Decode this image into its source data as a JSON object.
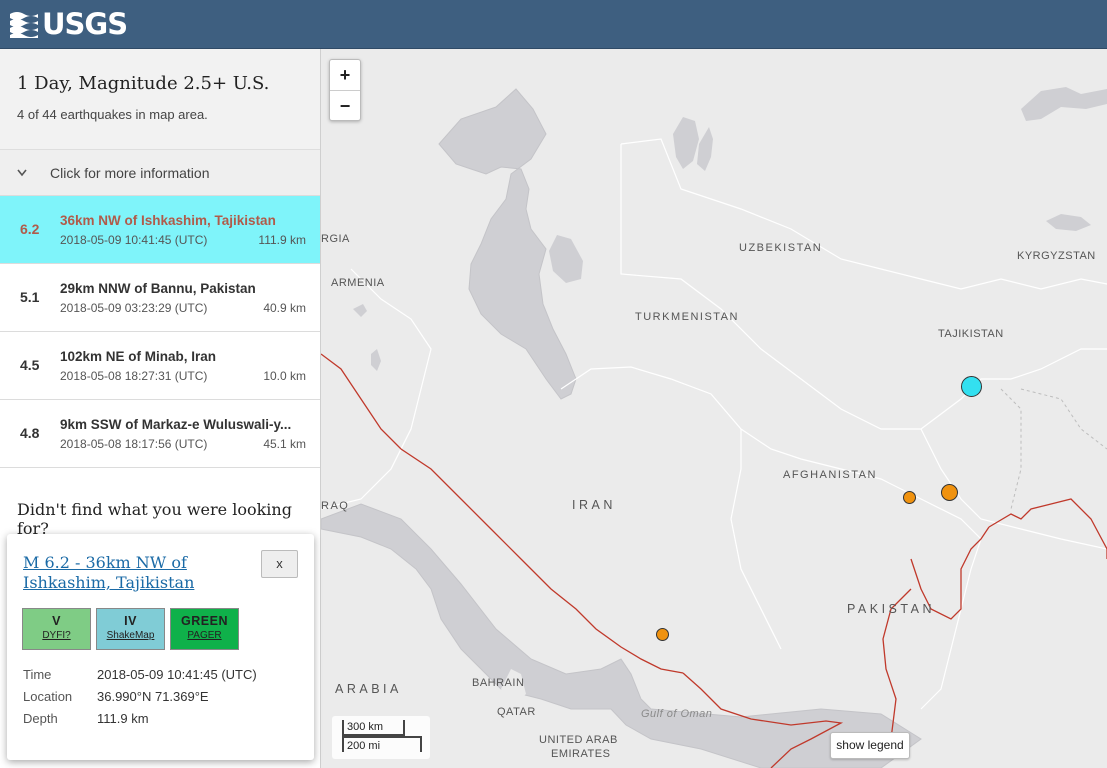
{
  "header": {
    "logo_text": "USGS"
  },
  "sidebar": {
    "title": "1 Day, Magnitude 2.5+ U.S.",
    "subtitle": "4 of 44 earthquakes in map area.",
    "more_info": "Click for more information",
    "quakes": [
      {
        "mag": "6.2",
        "place": "36km NW of Ishkashim, Tajikistan",
        "time": "2018-05-09 10:41:45 (UTC)",
        "depth": "111.9 km",
        "selected": true
      },
      {
        "mag": "5.1",
        "place": "29km NNW of Bannu, Pakistan",
        "time": "2018-05-09 03:23:29 (UTC)",
        "depth": "40.9 km",
        "selected": false
      },
      {
        "mag": "4.5",
        "place": "102km NE of Minab, Iran",
        "time": "2018-05-08 18:27:31 (UTC)",
        "depth": "10.0 km",
        "selected": false
      },
      {
        "mag": "4.8",
        "place": "9km SSW of Markaz-e Wuluswali-y...",
        "time": "2018-05-08 18:17:56 (UTC)",
        "depth": "45.1 km",
        "selected": false
      }
    ],
    "didnt_find": "Didn't find what you were looking for?"
  },
  "map": {
    "zoom_in": "+",
    "zoom_out": "−",
    "scale_km": "300 km",
    "scale_mi": "200 mi",
    "show_legend": "show legend",
    "labels": {
      "uzbekistan": "UZBEKISTAN",
      "kyrgyzstan": "KYRGYZSTAN",
      "turkmenistan": "TURKMENISTAN",
      "tajikistan": "TAJIKISTAN",
      "afghanistan": "AFGHANISTAN",
      "iran": "IRAN",
      "pakistan": "PAKISTAN",
      "armenia": "ARMENIA",
      "georgia": "RGIA",
      "iraq": "RAQ",
      "arabia": "ARABIA",
      "bahrain": "BAHRAIN",
      "qatar": "QATAR",
      "uae_1": "UNITED ARAB",
      "uae_2": "EMIRATES",
      "gulf_of_oman": "Gulf of Oman"
    },
    "colors": {
      "land": "#ebebeb",
      "water": "#cfcfd3",
      "plate_boundary": "#c0392b",
      "highlight_quake": "#33e0f0",
      "quake": "#f0920f"
    }
  },
  "popup": {
    "title": "M 6.2 - 36km NW of Ishkashim, Tajikistan",
    "close": "x",
    "badges": [
      {
        "value": "V",
        "label": "DYFI?",
        "color": "#7fcc85"
      },
      {
        "value": "IV",
        "label": "ShakeMap",
        "color": "#80ccd6"
      },
      {
        "value": "GREEN",
        "label": "PAGER",
        "color": "#0fb14a"
      }
    ],
    "rows": [
      {
        "key": "Time",
        "value": "2018-05-09 10:41:45 (UTC)"
      },
      {
        "key": "Location",
        "value": "36.990°N 71.369°E"
      },
      {
        "key": "Depth",
        "value": "111.9 km"
      }
    ]
  }
}
